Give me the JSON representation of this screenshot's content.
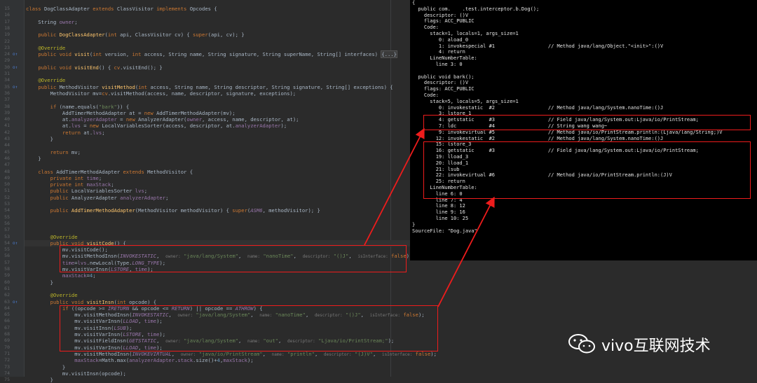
{
  "watermark": {
    "text": "vivo互联网技术"
  },
  "editor": {
    "lines": [
      {
        "n": "15",
        "html": "<span class=\"kw\">class</span> DogClassAdapter <span class=\"kw\">extends</span> ClassVisitor <span class=\"kw\">implements</span> Opcodes {"
      },
      {
        "n": "16",
        "html": ""
      },
      {
        "n": "17",
        "html": "    String <span class=\"fld\">owner</span>;"
      },
      {
        "n": "18",
        "html": ""
      },
      {
        "n": "19",
        "html": "    <span class=\"kw\">public</span> <span class=\"fn\">DogClassAdapter</span>(<span class=\"kw\">int</span> api, ClassVisitor cv) { <span class=\"kw\">super</span>(api, cv); }"
      },
      {
        "n": "22",
        "html": ""
      },
      {
        "n": "23",
        "html": "    <span class=\"ann\">@Override</span>"
      },
      {
        "n": "24",
        "icon": true,
        "html": "    <span class=\"kw\">public void</span> <span class=\"fn\">visit</span>(<span class=\"kw\">int</span> version, <span class=\"kw\">int</span> access, String name, String signature, String superName, String[] interfaces) <span class=\"fold\">{...}</span>"
      },
      {
        "n": "29",
        "html": ""
      },
      {
        "n": "30",
        "icon": true,
        "html": "    <span class=\"kw\">public void</span> <span class=\"fn\">visitEnd</span>() { <span class=\"kw\">cv</span>.visitEnd(); }"
      },
      {
        "n": "31",
        "html": ""
      },
      {
        "n": "34",
        "html": "    <span class=\"ann\">@Override</span>"
      },
      {
        "n": "35",
        "icon": true,
        "html": "    <span class=\"kw\">public</span> MethodVisitor <span class=\"fn\">visitMethod</span>(<span class=\"kw\">int</span> access, String name, String descriptor, String signature, String[] exceptions) {"
      },
      {
        "n": "36",
        "html": "        MethodVisitor mv=<span class=\"kw\">cv</span>.visitMethod(access, name, descriptor, signature, exceptions);"
      },
      {
        "n": "37",
        "html": ""
      },
      {
        "n": "38",
        "html": "        <span class=\"kw\">if</span> (name.equals(<span class=\"str\">\"bark\"</span>)) {"
      },
      {
        "n": "39",
        "html": "            AddTimerMethodAdapter at = <span class=\"kw\">new</span> AddTimerMethodAdapter(mv);"
      },
      {
        "n": "40",
        "html": "            at.<span class=\"fld\">analyzerAdapter</span> = <span class=\"kw\">new</span> AnalyzerAdapter(<span class=\"fld\">owner</span>, access, name, descriptor, at);"
      },
      {
        "n": "41",
        "html": "            at.<span class=\"fld\">lvs</span> = <span class=\"kw\">new</span> LocalVariablesSorter(access, descriptor, at.<span class=\"fld\">analyzerAdapter</span>);"
      },
      {
        "n": "42",
        "html": "            <span class=\"kw\">return</span> at.<span class=\"fld\">lvs</span>;"
      },
      {
        "n": "43",
        "html": "        }"
      },
      {
        "n": "44",
        "html": ""
      },
      {
        "n": "45",
        "html": "        <span class=\"kw\">return</span> mv;"
      },
      {
        "n": "46",
        "html": "    }"
      },
      {
        "n": "47",
        "html": ""
      },
      {
        "n": "48",
        "html": "    <span class=\"kw\">class</span> AddTimerMethodAdapter <span class=\"kw\">extends</span> MethodVisitor {"
      },
      {
        "n": "49",
        "html": "        <span class=\"kw\">private int</span> <span class=\"fld\">time</span>;"
      },
      {
        "n": "50",
        "html": "        <span class=\"kw\">private int</span> <span class=\"fld\">maxStack</span>;"
      },
      {
        "n": "51",
        "html": "        <span class=\"kw\">public</span> LocalVariablesSorter <span class=\"fld\">lvs</span>;"
      },
      {
        "n": "52",
        "html": "        <span class=\"kw\">public</span> AnalyzerAdapter <span class=\"fld\">analyzerAdapter</span>;"
      },
      {
        "n": "53",
        "html": ""
      },
      {
        "n": "54",
        "html": "        <span class=\"kw\">public</span> <span class=\"fn\">AddTimerMethodAdapter</span>(MethodVisitor methodVisitor) { <span class=\"kw\">super</span>(<span class=\"cst\">ASM6</span>, methodVisitor); }"
      },
      {
        "n": "55",
        "html": ""
      },
      {
        "n": "56",
        "html": ""
      },
      {
        "n": "57",
        "html": ""
      },
      {
        "n": "53",
        "html": "        <span class=\"ann\">@Override</span>"
      },
      {
        "n": "54",
        "icon": true,
        "html": "        <span class=\"kw\">public void</span> <span class=\"fn\">visitCode</span>() {"
      },
      {
        "n": "55",
        "html": "            mv.visitCode();"
      },
      {
        "n": "56",
        "html": "            mv.visitMethodInsn(<span class=\"cst\">INVOKESTATIC</span>,  <span class=\"hint\">owner:</span> <span class=\"str\">\"java/lang/System\"</span>,  <span class=\"hint\">name:</span> <span class=\"str\">\"nanoTime\"</span>,  <span class=\"hint\">descriptor:</span> <span class=\"str\">\"()J\"</span>,  <span class=\"hint\">isInterface:</span> <span class=\"kw\">false</span>);"
      },
      {
        "n": "57",
        "html": "            <span class=\"fld\">time</span>=<span class=\"fld\">lvs</span>.newLocal(Type.<span class=\"cst\">LONG_TYPE</span>);"
      },
      {
        "n": "58",
        "html": "            mv.visitVarInsn(<span class=\"cst\">LSTORE</span>, <span class=\"fld\">time</span>);"
      },
      {
        "n": "59",
        "html": "            <span class=\"fld\">maxStack</span>=<span class=\"num\">4</span>;"
      },
      {
        "n": "60",
        "html": "        }"
      },
      {
        "n": "61",
        "html": ""
      },
      {
        "n": "62",
        "html": "        <span class=\"ann\">@Override</span>"
      },
      {
        "n": "63",
        "icon": true,
        "html": "        <span class=\"kw\">public void</span> <span class=\"fn\">visitInsn</span>(<span class=\"kw\">int</span> opcode) {"
      },
      {
        "n": "64",
        "html": "            <span class=\"kw\">if</span> ((opcode &gt;= <span class=\"cst\">IRETURN</span> &amp;&amp; opcode &lt;= <span class=\"cst\">RETURN</span>) || opcode == <span class=\"cst\">ATHROW</span>) {"
      },
      {
        "n": "65",
        "html": "                mv.visitMethodInsn(<span class=\"cst\">INVOKESTATIC</span>,  <span class=\"hint\">owner:</span> <span class=\"str\">\"java/lang/System\"</span>,  <span class=\"hint\">name:</span> <span class=\"str\">\"nanoTime\"</span>,  <span class=\"hint\">descriptor:</span> <span class=\"str\">\"()J\"</span>,  <span class=\"hint\">isInterface:</span> <span class=\"kw\">false</span>);"
      },
      {
        "n": "66",
        "html": "                mv.visitVarInsn(<span class=\"cst\">LLOAD</span>, <span class=\"fld\">time</span>);"
      },
      {
        "n": "67",
        "html": "                mv.visitInsn(<span class=\"cst\">LSUB</span>);"
      },
      {
        "n": "68",
        "html": "                mv.visitVarInsn(<span class=\"cst\">LSTORE</span>, <span class=\"fld\">time</span>);"
      },
      {
        "n": "69",
        "html": "                mv.visitFieldInsn(<span class=\"cst\">GETSTATIC</span>,  <span class=\"hint\">owner:</span> <span class=\"str\">\"java/lang/System\"</span>,  <span class=\"hint\">name:</span> <span class=\"str\">\"out\"</span>,  <span class=\"hint\">descriptor:</span> <span class=\"str\">\"Ljava/io/PrintStream;\"</span>);"
      },
      {
        "n": "70",
        "html": "                mv.visitVarInsn(<span class=\"cst\">LLOAD</span>, <span class=\"fld\">time</span>);"
      },
      {
        "n": "71",
        "html": "                mv.visitMethodInsn(<span class=\"cst\">INVOKEVIRTUAL</span>,  <span class=\"hint\">owner:</span> <span class=\"str\">\"java/io/PrintStream\"</span>,  <span class=\"hint\">name:</span> <span class=\"str\">\"println\"</span>,  <span class=\"hint\">descriptor:</span> <span class=\"str\">\"(J)V\"</span>,  <span class=\"hint\">isInterface:</span> <span class=\"kw\">false</span>);"
      },
      {
        "n": "72",
        "html": "                <span class=\"fld\">maxStack</span>=Math.max(<span class=\"fld\">analyzerAdapter</span>.<span class=\"fld\">stack</span>.size()+<span class=\"num\">4</span>,<span class=\"fld\">maxStack</span>);"
      },
      {
        "n": "73",
        "html": "            }"
      },
      {
        "n": "74",
        "html": "            mv.visitInsn(opcode);"
      },
      {
        "n": "75",
        "html": "        }"
      }
    ]
  },
  "terminal": {
    "lines": [
      "{",
      "  public com.    .test.interceptor.b.Dog();",
      "    descriptor: ()V",
      "    flags: ACC_PUBLIC",
      "    Code:",
      "      stack=1, locals=1, args_size=1",
      "         0: aload_0",
      "         1: invokespecial #1                  // Method java/lang/Object.\"<init>\":()V",
      "         4: return",
      "      LineNumberTable:",
      "        line 3: 0",
      "",
      "  public void bark();",
      "    descriptor: ()V",
      "    flags: ACC_PUBLIC",
      "    Code:",
      "      stack=5, locals=5, args_size=1",
      "         0: invokestatic  #2                  // Method java/lang/System.nanoTime:()J",
      "         3: lstore_1",
      "         4: getstatic     #3                  // Field java/lang/System.out:Ljava/io/PrintStream;",
      "         7: ldc           #4                  // String wang wang~",
      "         9: invokevirtual #5                  // Method java/io/PrintStream.println:(Ljava/lang/String;)V",
      "        12: invokestatic  #2                  // Method java/lang/System.nanoTime:()J",
      "        15: lstore_3",
      "        16: getstatic     #3                  // Field java/lang/System.out:Ljava/io/PrintStream;",
      "        19: lload_3",
      "        20: lload_1",
      "        21: lsub",
      "        22: invokevirtual #6                  // Method java/io/PrintStream.println:(J)V",
      "        25: return",
      "      LineNumberTable:",
      "        line 6: 0",
      "        line 7: 4",
      "        line 8: 12",
      "        line 9: 16",
      "        line 10: 25",
      "}",
      "SourceFile: \"Dog.java\""
    ]
  }
}
